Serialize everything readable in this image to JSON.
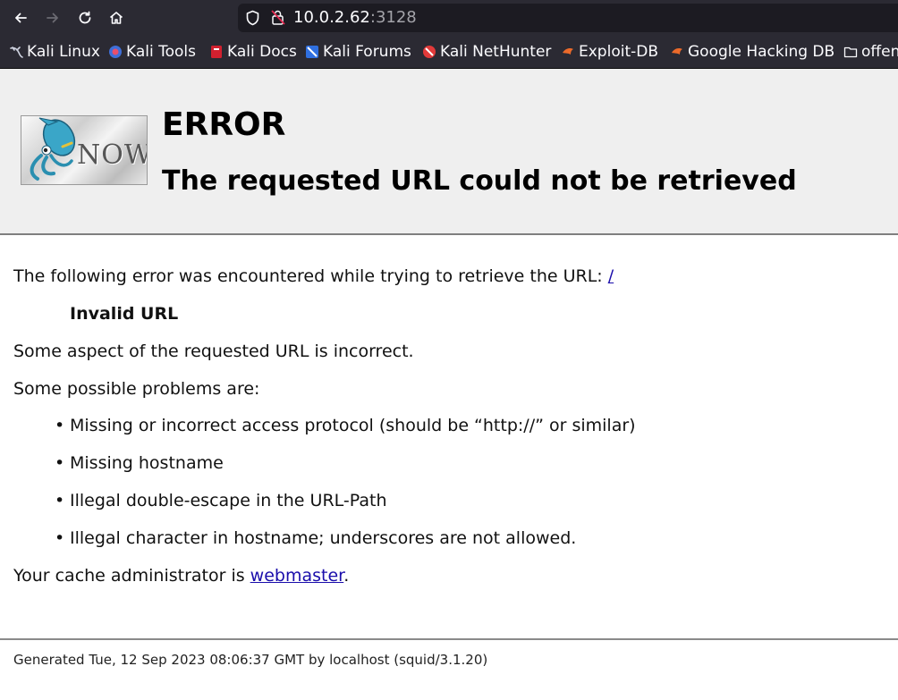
{
  "browser": {
    "url_host": "10.0.2.62",
    "url_port": ":3128",
    "bookmarks": [
      {
        "label": "Kali Linux",
        "icon": "kali-dragon-icon"
      },
      {
        "label": "Kali Tools",
        "icon": "kali-tools-icon"
      },
      {
        "label": "Kali Docs",
        "icon": "kali-docs-icon"
      },
      {
        "label": "Kali Forums",
        "icon": "kali-forums-icon"
      },
      {
        "label": "Kali NetHunter",
        "icon": "kali-nethunter-icon"
      },
      {
        "label": "Exploit-DB",
        "icon": "exploit-db-icon"
      },
      {
        "label": "Google Hacking DB",
        "icon": "ghdb-icon"
      },
      {
        "label": "offen",
        "icon": "folder-icon"
      }
    ]
  },
  "error": {
    "title": "ERROR",
    "subtitle": "The requested URL could not be retrieved",
    "intro": "The following error was encountered while trying to retrieve the URL: ",
    "url_link": "/",
    "error_name": "Invalid URL",
    "description": "Some aspect of the requested URL is incorrect.",
    "problems_heading": "Some possible problems are:",
    "problems": [
      "Missing or incorrect access protocol (should be “http://” or similar)",
      "Missing hostname",
      "Illegal double-escape in the URL-Path",
      "Illegal character in hostname; underscores are not allowed."
    ],
    "admin_prefix": "Your cache administrator is ",
    "admin_link": "webmaster",
    "admin_suffix": ".",
    "footer": "Generated Tue, 12 Sep 2023 08:06:37 GMT by localhost (squid/3.1.20)"
  },
  "logo_text": "NOW"
}
